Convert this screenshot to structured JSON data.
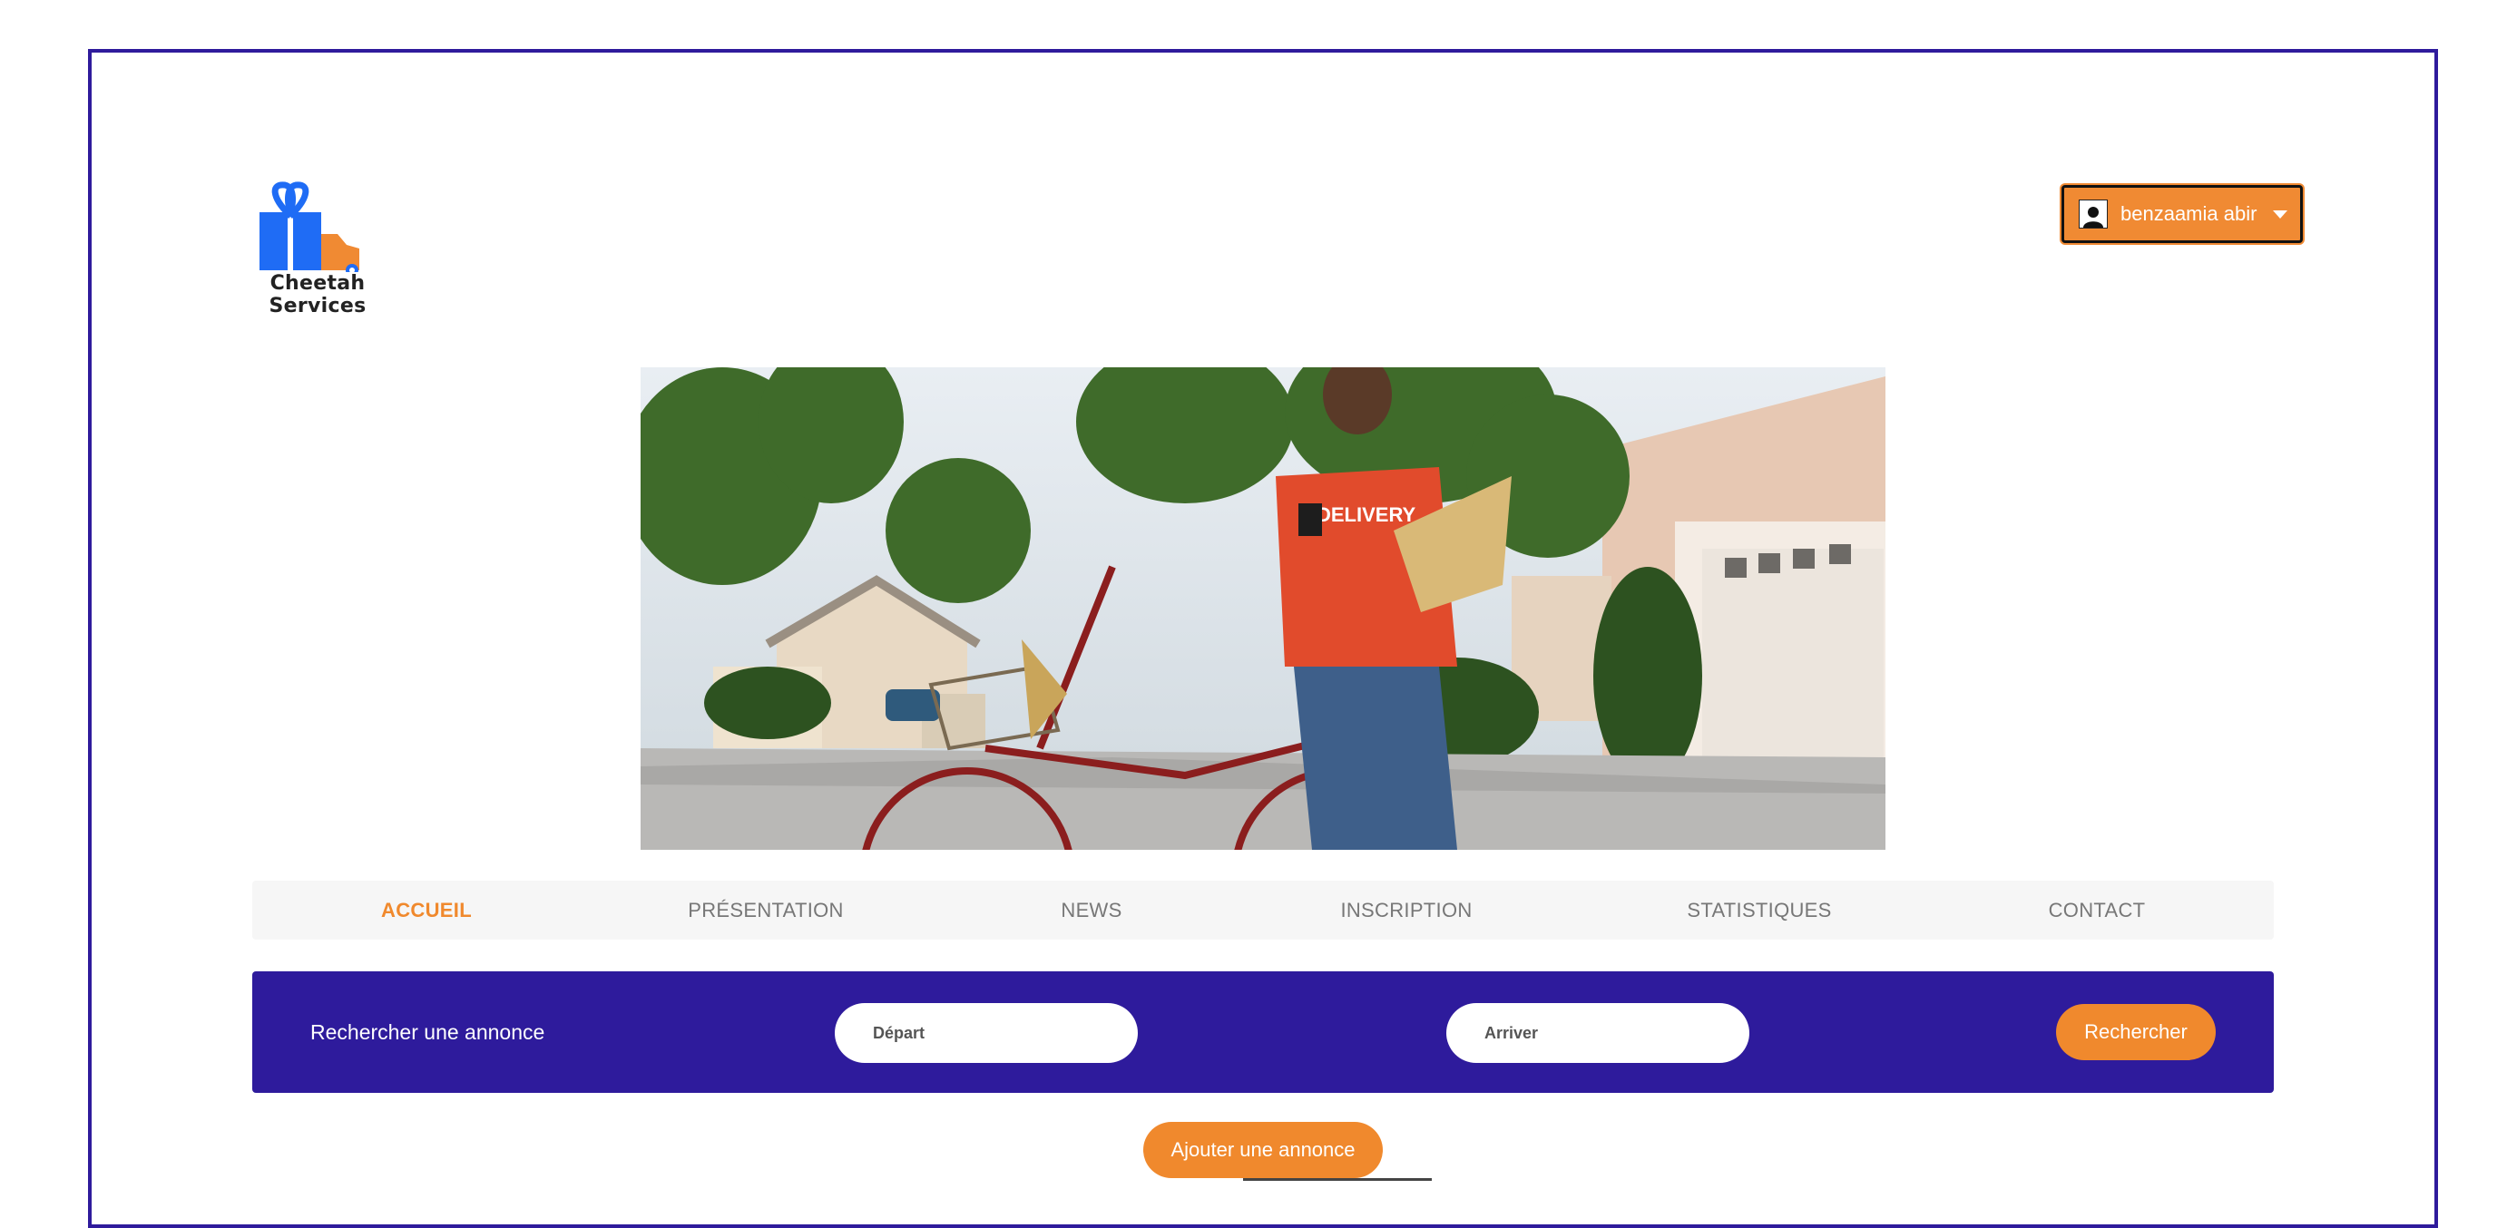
{
  "brand": {
    "name": "Cheetah Services",
    "colors": {
      "primary": "#2e1b9c",
      "accent": "#f0892d",
      "logo_blue": "#1f6cf5",
      "logo_orange": "#f08a33"
    }
  },
  "user_menu": {
    "name": "benzaamia abir",
    "icon": "user-avatar-icon"
  },
  "hero": {
    "description_visible": "DELIVERY"
  },
  "nav": {
    "items": [
      {
        "label": "ACCUEIL",
        "active": true
      },
      {
        "label": "PRÉSENTATION",
        "active": false
      },
      {
        "label": "NEWS",
        "active": false
      },
      {
        "label": "INSCRIPTION",
        "active": false
      },
      {
        "label": "STATISTIQUES",
        "active": false
      },
      {
        "label": "CONTACT",
        "active": false
      }
    ]
  },
  "search": {
    "title": "Rechercher une annonce",
    "departure_placeholder": "Départ",
    "arrival_placeholder": "Arriver",
    "submit_label": "Rechercher"
  },
  "actions": {
    "add_listing_label": "Ajouter une annonce"
  }
}
